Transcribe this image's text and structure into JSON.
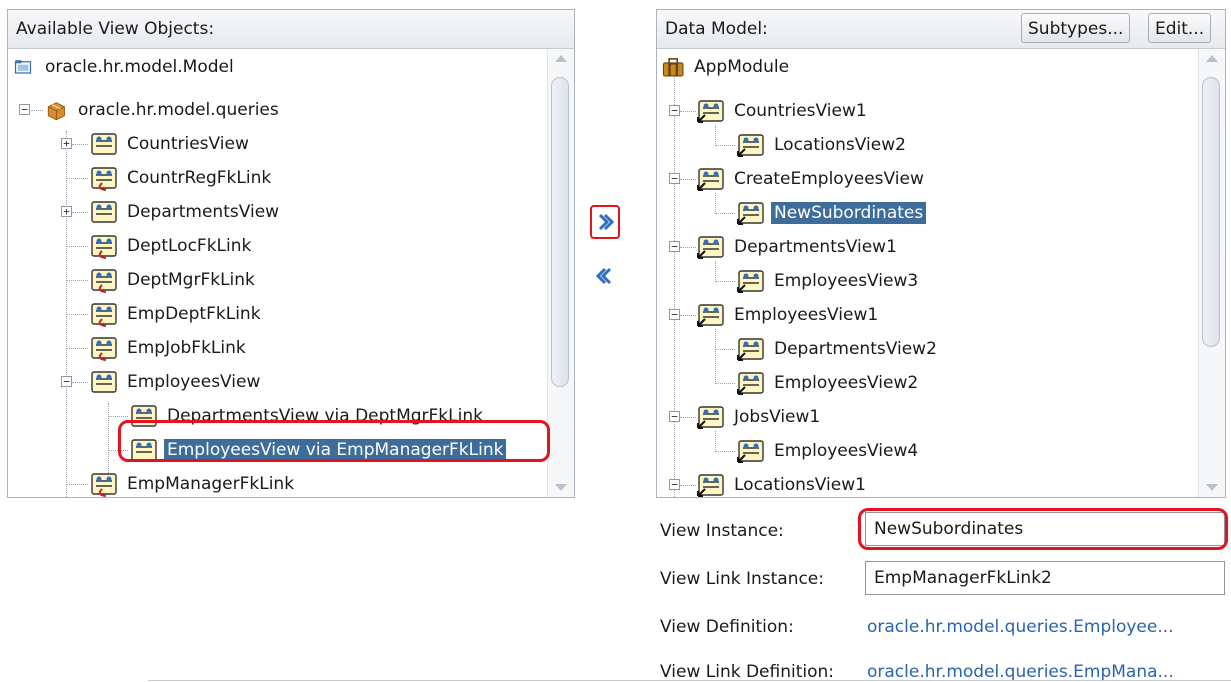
{
  "left_panel": {
    "title": "Available View Objects:",
    "nodes": [
      {
        "label": "oracle.hr.model.Model",
        "icon": "folder-icon"
      },
      {
        "label": "oracle.hr.model.queries",
        "icon": "package-icon"
      },
      {
        "label": "CountriesView",
        "icon": "view-object-icon"
      },
      {
        "label": "CountrRegFkLink",
        "icon": "view-link-icon"
      },
      {
        "label": "DepartmentsView",
        "icon": "view-object-icon"
      },
      {
        "label": "DeptLocFkLink",
        "icon": "view-link-icon"
      },
      {
        "label": "DeptMgrFkLink",
        "icon": "view-link-icon"
      },
      {
        "label": "EmpDeptFkLink",
        "icon": "view-link-icon"
      },
      {
        "label": "EmpJobFkLink",
        "icon": "view-link-icon"
      },
      {
        "label": "EmployeesView",
        "icon": "view-object-icon"
      },
      {
        "label": "DepartmentsView via DeptMgrFkLink",
        "icon": "view-object-icon"
      },
      {
        "label": "EmployeesView via EmpManagerFkLink",
        "icon": "view-object-icon",
        "selected": true
      },
      {
        "label": "EmpManagerFkLink",
        "icon": "view-link-icon"
      }
    ]
  },
  "shuttle": {
    "add": "add-arrow-icon",
    "remove": "remove-arrow-icon"
  },
  "right_panel": {
    "title": "Data Model:",
    "subtypes_button": "Subtypes...",
    "edit_button": "Edit...",
    "nodes": [
      {
        "label": "AppModule",
        "icon": "application-module-icon"
      },
      {
        "label": "CountriesView1",
        "icon": "view-instance-icon"
      },
      {
        "label": "LocationsView2",
        "icon": "view-instance-icon"
      },
      {
        "label": "CreateEmployeesView",
        "icon": "view-instance-icon"
      },
      {
        "label": "NewSubordinates",
        "icon": "view-instance-icon",
        "selected": true
      },
      {
        "label": "DepartmentsView1",
        "icon": "view-instance-icon"
      },
      {
        "label": "EmployeesView3",
        "icon": "view-instance-icon"
      },
      {
        "label": "EmployeesView1",
        "icon": "view-instance-icon"
      },
      {
        "label": "DepartmentsView2",
        "icon": "view-instance-icon"
      },
      {
        "label": "EmployeesView2",
        "icon": "view-instance-icon"
      },
      {
        "label": "JobsView1",
        "icon": "view-instance-icon"
      },
      {
        "label": "EmployeesView4",
        "icon": "view-instance-icon"
      },
      {
        "label": "LocationsView1",
        "icon": "view-instance-icon"
      }
    ]
  },
  "properties": {
    "view_instance_label": "View Instance:",
    "view_instance_value": "NewSubordinates",
    "view_link_instance_label": "View Link Instance:",
    "view_link_instance_value": "EmpManagerFkLink2",
    "view_definition_label": "View Definition:",
    "view_definition_value": "oracle.hr.model.queries.Employee...",
    "view_link_definition_label": "View Link Definition:",
    "view_link_definition_value": "oracle.hr.model.queries.EmpMana..."
  },
  "colors": {
    "highlight": "#e3141f",
    "selection": "#3e6d9c",
    "link": "#2a63b0"
  }
}
